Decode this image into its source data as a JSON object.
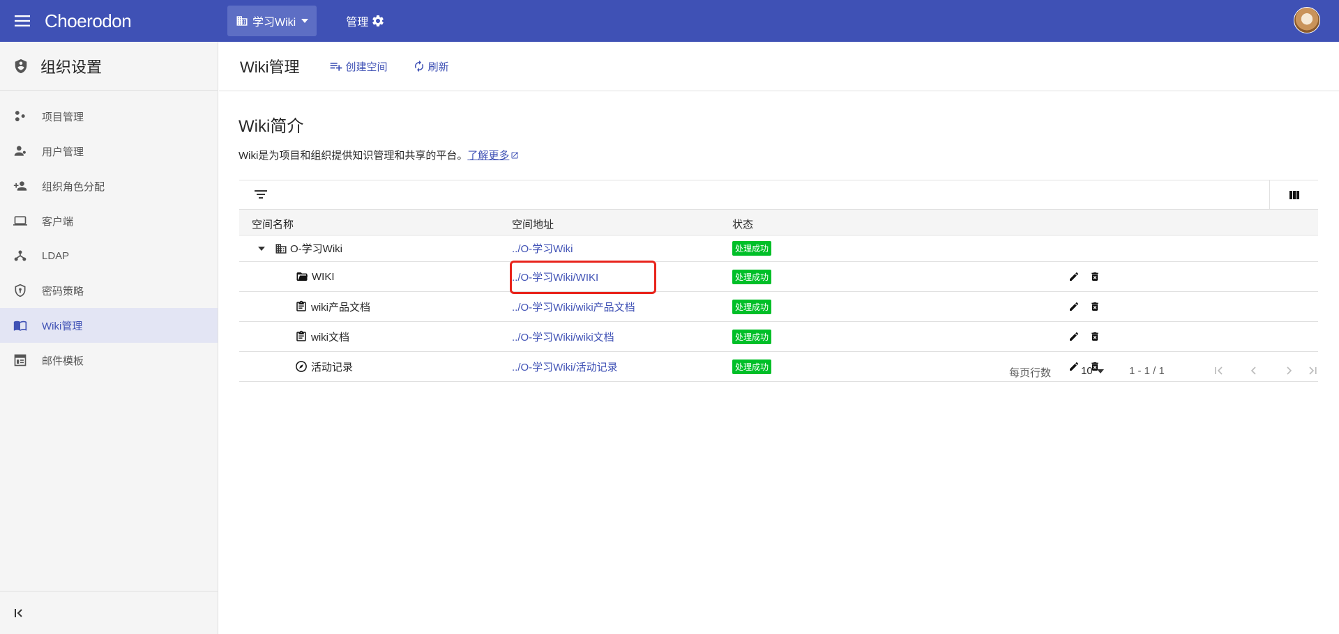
{
  "topbar": {
    "brand": "Choerodon",
    "org_selector": "学习Wiki",
    "manage_label": "管理"
  },
  "sidebar": {
    "title": "组织设置",
    "items": [
      {
        "label": "项目管理",
        "icon": "project-icon"
      },
      {
        "label": "用户管理",
        "icon": "user-icon"
      },
      {
        "label": "组织角色分配",
        "icon": "person-add-icon"
      },
      {
        "label": "客户端",
        "icon": "laptop-icon"
      },
      {
        "label": "LDAP",
        "icon": "ldap-icon"
      },
      {
        "label": "密码策略",
        "icon": "shield-icon"
      },
      {
        "label": "Wiki管理",
        "icon": "book-icon",
        "active": true
      },
      {
        "label": "邮件模板",
        "icon": "template-icon"
      }
    ]
  },
  "header": {
    "title": "Wiki管理",
    "create_label": "创建空间",
    "refresh_label": "刷新"
  },
  "intro": {
    "title": "Wiki简介",
    "description": "Wiki是为项目和组织提供知识管理和共享的平台。",
    "link_label": "了解更多"
  },
  "table": {
    "columns": [
      "空间名称",
      "空间地址",
      "状态"
    ],
    "rows": [
      {
        "name": "O-学习Wiki",
        "address": "../O-学习Wiki",
        "status": "处理成功",
        "icon": "building-icon",
        "expandable": true
      },
      {
        "name": "WIKI",
        "address": "../O-学习Wiki/WIKI",
        "status": "处理成功",
        "icon": "folder-open-icon"
      },
      {
        "name": "wiki产品文档",
        "address": "../O-学习Wiki/wiki产品文档",
        "status": "处理成功",
        "icon": "clipboard-icon"
      },
      {
        "name": "wiki文档",
        "address": "../O-学习Wiki/wiki文档",
        "status": "处理成功",
        "icon": "clipboard-icon"
      },
      {
        "name": "活动记录",
        "address": "../O-学习Wiki/活动记录",
        "status": "处理成功",
        "icon": "compass-icon"
      }
    ]
  },
  "pagination": {
    "rows_per_page_label": "每页行数",
    "page_size": "10",
    "range": "1 - 1 / 1"
  },
  "colors": {
    "primary": "#3f51b5",
    "success": "#00bf28",
    "highlight": "#e8241c"
  }
}
